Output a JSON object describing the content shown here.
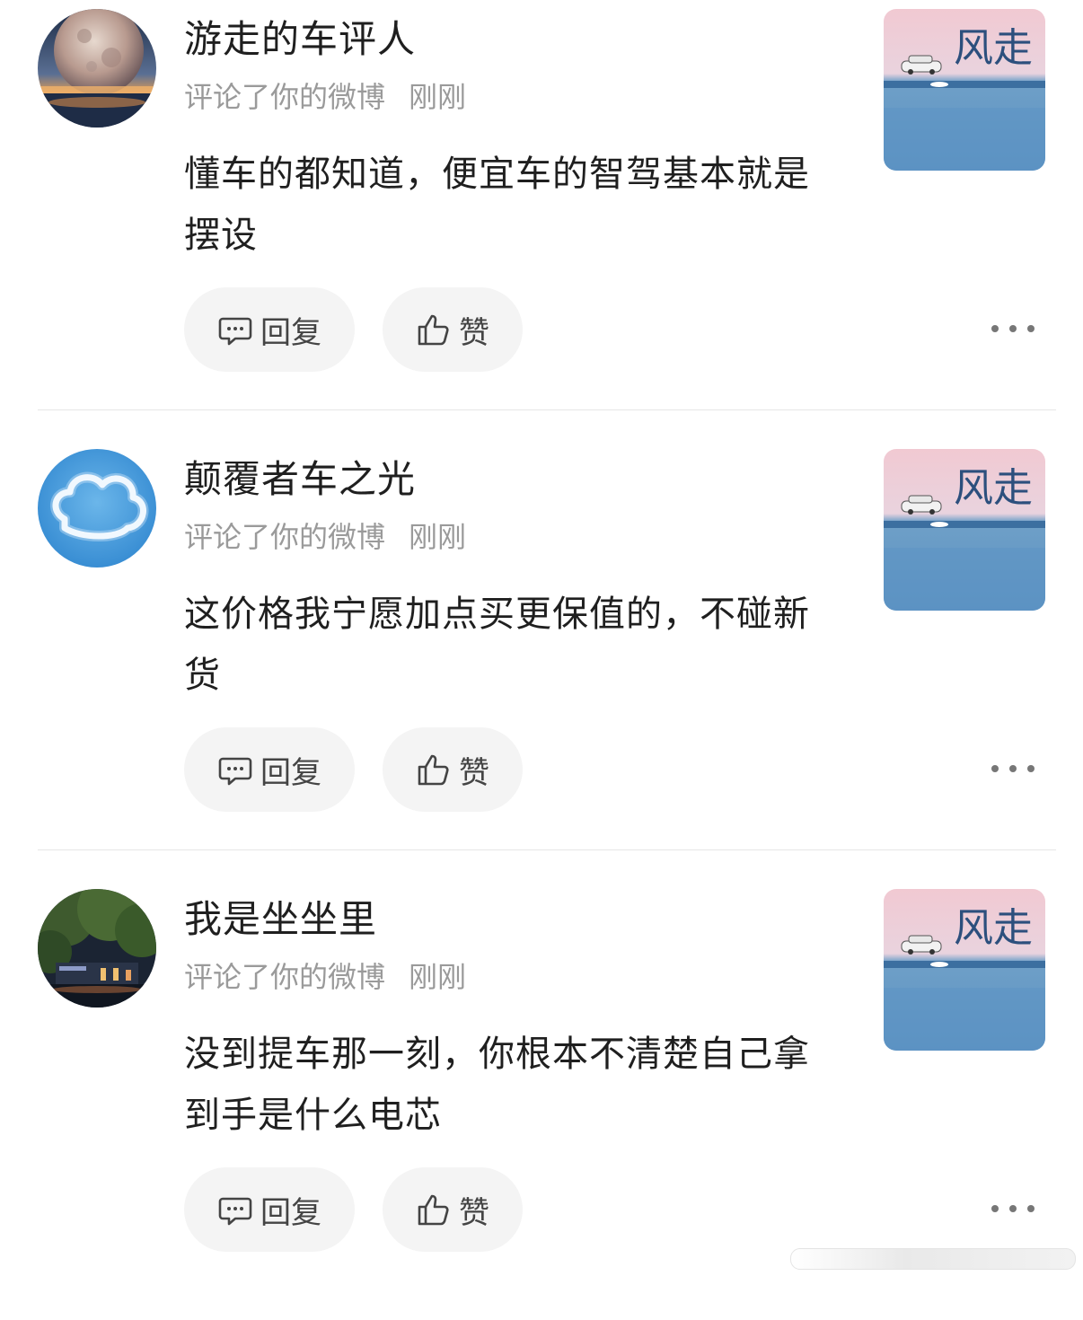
{
  "notifications": [
    {
      "username": "游走的车评人",
      "action": "评论了你的微博",
      "time": "刚刚",
      "comment": "懂车的都知道，便宜车的智驾基本就是摆设",
      "avatar": "moon-avatar",
      "reply_label": "回复",
      "like_label": "赞"
    },
    {
      "username": "颠覆者车之光",
      "action": "评论了你的微博",
      "time": "刚刚",
      "comment": "这价格我宁愿加点买更保值的，不碰新货",
      "avatar": "cloud-avatar",
      "reply_label": "回复",
      "like_label": "赞"
    },
    {
      "username": "我是坐坐里",
      "action": "评论了你的微博",
      "time": "刚刚",
      "comment": "没到提车那一刻，你根本不清楚自己拿到手是什么电芯",
      "avatar": "night-tree-avatar",
      "reply_label": "回复",
      "like_label": "赞"
    }
  ],
  "thumbnail": {
    "title_chars": "风走"
  },
  "colors": {
    "button_bg": "#f4f4f4",
    "meta_text": "#9a9a9a",
    "divider": "#e6e6e6"
  }
}
